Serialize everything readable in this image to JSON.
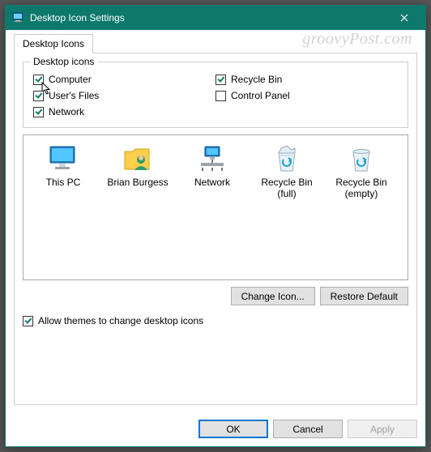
{
  "window": {
    "title": "Desktop Icon Settings"
  },
  "tab": {
    "label": "Desktop Icons"
  },
  "group": {
    "legend": "Desktop icons",
    "items": {
      "computer": {
        "label": "Computer",
        "checked": true
      },
      "users_files": {
        "label": "User's Files",
        "checked": true
      },
      "network": {
        "label": "Network",
        "checked": true
      },
      "recycle_bin": {
        "label": "Recycle Bin",
        "checked": true
      },
      "control_panel": {
        "label": "Control Panel",
        "checked": false
      }
    }
  },
  "icons": {
    "this_pc": {
      "label": "This PC"
    },
    "user": {
      "label": "Brian Burgess"
    },
    "network": {
      "label": "Network"
    },
    "recycle_full": {
      "label": "Recycle Bin (full)"
    },
    "recycle_empty": {
      "label": "Recycle Bin (empty)"
    }
  },
  "buttons": {
    "change_icon": "Change Icon...",
    "restore_default": "Restore Default",
    "ok": "OK",
    "cancel": "Cancel",
    "apply": "Apply"
  },
  "allow_themes": {
    "label": "Allow themes to change desktop icons",
    "checked": true
  },
  "watermark": "groovyPost.com"
}
